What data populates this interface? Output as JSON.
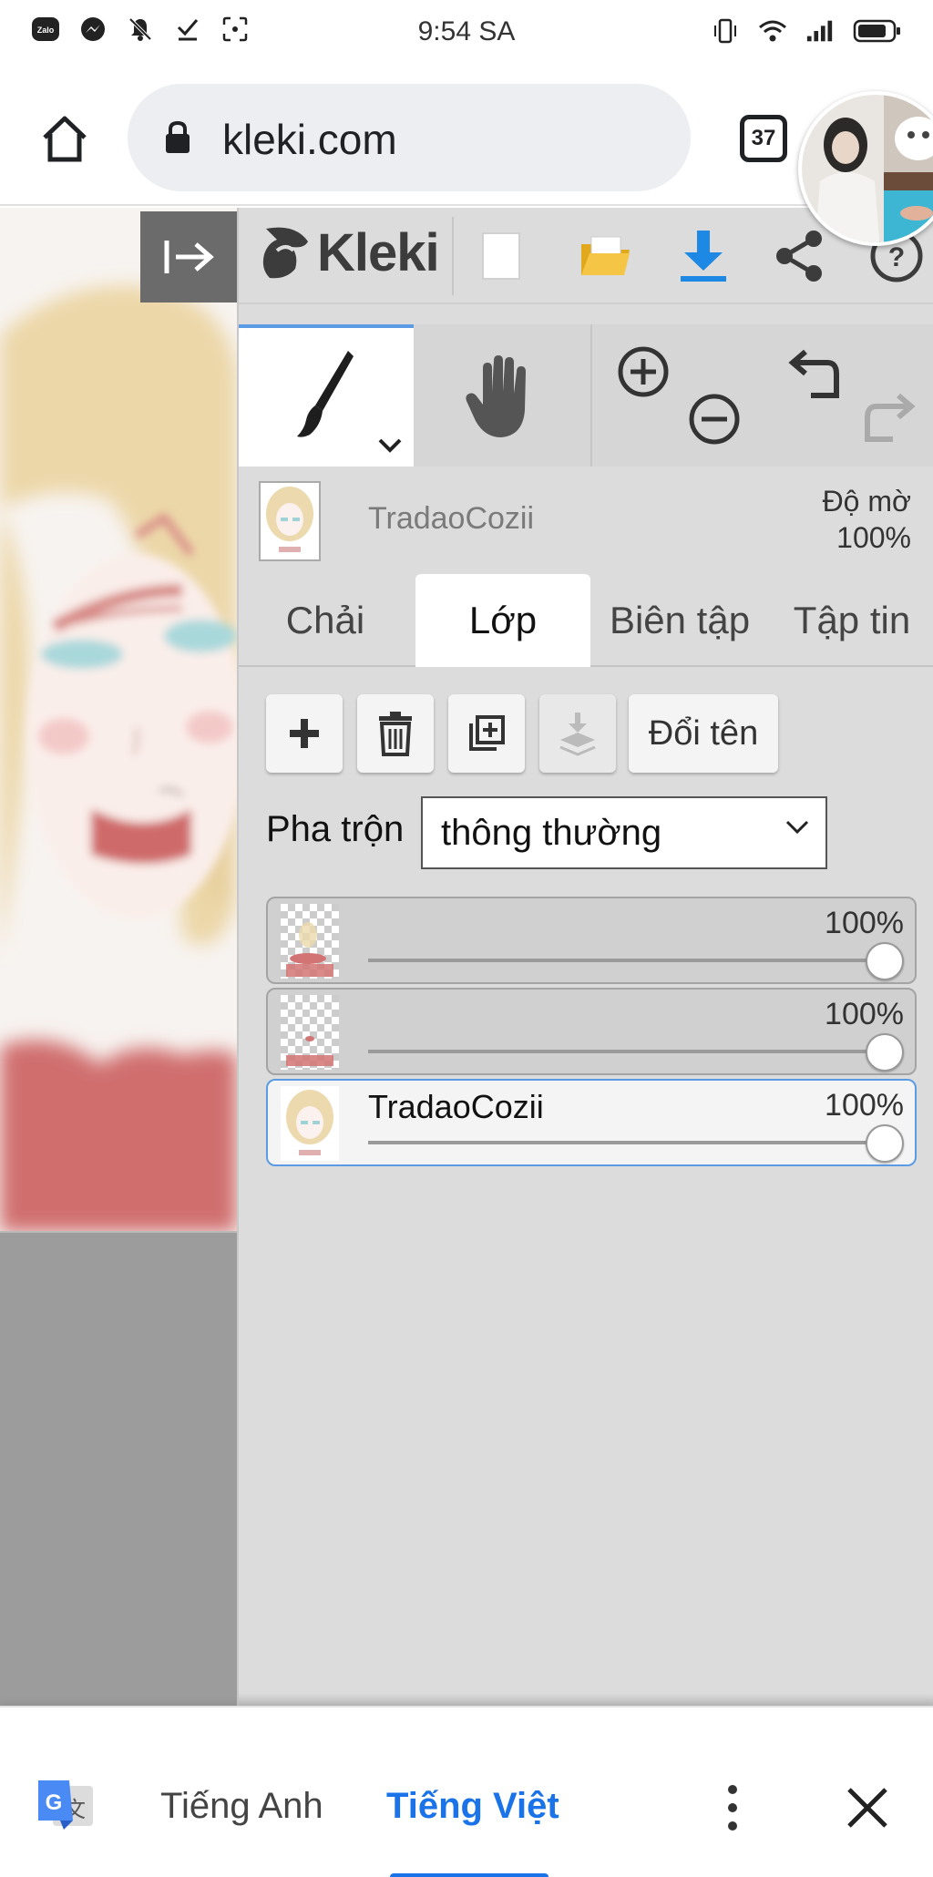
{
  "status_bar": {
    "time": "9:54 SA",
    "left_icons": [
      "zalo-icon",
      "messenger-icon",
      "notifications-off-icon",
      "task-done-icon",
      "screenshot-icon"
    ],
    "right_icons": [
      "vibrate-icon",
      "wifi-icon",
      "signal-icon",
      "battery-icon"
    ]
  },
  "browser": {
    "url": "kleki.com",
    "tab_count": "37"
  },
  "kleki": {
    "logo_text": "Kleki",
    "toolbar_icons": [
      "new-file-icon",
      "open-folder-icon",
      "download-icon",
      "share-icon",
      "help-icon"
    ],
    "layer_name": "TradaoCozii",
    "opacity_label": "Độ mờ",
    "opacity_value": "100%",
    "tabs": [
      "Chải",
      "Lớp",
      "Biên tập",
      "Tập tin"
    ],
    "active_tab": "Lớp",
    "rename_label": "Đổi tên",
    "blend_label": "Pha trộn",
    "blend_value": "thông thường",
    "layers": [
      {
        "name": "",
        "opacity": "100%",
        "active": false
      },
      {
        "name": "",
        "opacity": "100%",
        "active": false
      },
      {
        "name": "TradaoCozii",
        "opacity": "100%",
        "active": true
      }
    ],
    "accent_color": "#5a9be3"
  },
  "translate": {
    "lang_source": "Tiếng Anh",
    "lang_target": "Tiếng Việt",
    "accent_color": "#1a73e8"
  }
}
